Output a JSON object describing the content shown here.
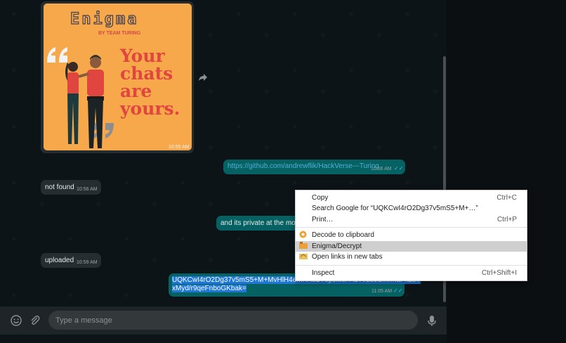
{
  "messages": {
    "image_time": "10:55 AM",
    "poster": {
      "logo": "Enigma",
      "by": "BY TEAM TURING",
      "headline": [
        "Your",
        "chats",
        "are",
        "yours."
      ]
    },
    "github_link": {
      "text": "https://github.com/andrewflik/HackVerse---Turing",
      "time": "10:56 AM"
    },
    "not_found": {
      "text": "not found",
      "time": "10:56 AM"
    },
    "private": {
      "text": "and its private at the mom"
    },
    "uploaded": {
      "text": "uploaded",
      "time": "10:59 AM"
    },
    "encrypted": {
      "line1": "UQKCwI4rO2Dg37v5mS5+M+MvHlH4eMXKbD7epskIuFA1Tvdu3SmrrnaPkzbY",
      "line2": "xMyd/r9qeFnboGKbak=",
      "time": "11:05 AM"
    },
    "tick_glyph": "✓✓"
  },
  "composer": {
    "placeholder": "Type a message"
  },
  "icons": {
    "forward": "forward-icon",
    "emoji": "emoji-icon",
    "attach": "paperclip-icon",
    "mic": "microphone-icon"
  },
  "context_menu": {
    "items": [
      {
        "label": "Copy",
        "shortcut": "Ctrl+C"
      },
      {
        "label": "Search Google for “UQKCwI4rO2Dg37v5mS5+M+…”",
        "shortcut": ""
      },
      {
        "label": "Print…",
        "shortcut": "Ctrl+P"
      },
      {
        "label": "Decode to clipboard",
        "shortcut": ""
      },
      {
        "label": "Enigma/Decrypt",
        "shortcut": ""
      },
      {
        "label": "Open links in new tabs",
        "shortcut": ""
      },
      {
        "label": "Inspect",
        "shortcut": "Ctrl+Shift+I"
      }
    ]
  },
  "colors": {
    "outgoing": "#056162",
    "incoming": "#262d31",
    "selection": "#1e77d3"
  }
}
